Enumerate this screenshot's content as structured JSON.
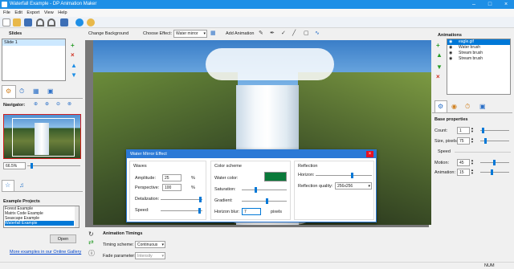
{
  "window": {
    "title": "Waterfall Example - DP Animation Maker"
  },
  "menu": [
    "File",
    "Edit",
    "Export",
    "View",
    "Help"
  ],
  "editbar": {
    "change_background": "Change Background",
    "choose_effect_label": "Choose Effect:",
    "effect_value": "Water mirror",
    "add_animation": "Add Animation"
  },
  "slides": {
    "title": "Slides",
    "items": [
      "Slide 1"
    ]
  },
  "navigator": {
    "title": "Navigator:",
    "zoom": "66.5%"
  },
  "projects": {
    "title": "Example Projects",
    "items": [
      "Forest Example",
      "Matrix Code Example",
      "Seascape Example",
      "Waterfall Example"
    ],
    "selected": 3,
    "open_label": "Open",
    "gallery_link": "More examples in our Online Gallery"
  },
  "timings": {
    "title": "Animation Timings",
    "timing_label": "Timing scheme:",
    "timing_value": "Continuous",
    "fade_label": "Fade parameter:",
    "fade_value": "Intensity"
  },
  "animations": {
    "title": "Animations",
    "items": [
      "eagle.gif",
      "Water brush",
      "Stream brush",
      "Stream brush"
    ],
    "selected": 0
  },
  "base_properties": {
    "title": "Base properties",
    "count_label": "Count:",
    "count_value": "1",
    "size_label": "Size, pixels:",
    "size_value": "75",
    "speed_header": "Speed",
    "motion_label": "Motion:",
    "motion_value": "45",
    "animation_label": "Animation:",
    "animation_value": "15"
  },
  "dialog": {
    "title": "Water Mirror Effect",
    "waves": {
      "header": "Waves",
      "amplitude_label": "Amplitude:",
      "amplitude_value": "25",
      "amplitude_unit": "%",
      "perspective_label": "Perspective:",
      "perspective_value": "100",
      "perspective_unit": "%",
      "detalization_label": "Detalization:",
      "speed_label": "Speed:"
    },
    "color_scheme": {
      "header": "Color scheme",
      "water_color_label": "Water color:",
      "water_color": "#0a7a3a",
      "saturation_label": "Saturation:",
      "gradient_label": "Gradient:",
      "horizon_blur_label": "Horizon blur:",
      "horizon_blur_value": "7",
      "horizon_blur_unit": "pixels"
    },
    "reflection": {
      "header": "Reflection",
      "horizon_label": "Horizon:",
      "quality_label": "Reflection quality:",
      "quality_value": "256x256"
    }
  },
  "statusbar": {
    "num": "NUM"
  },
  "colors": {
    "accent": "#1e8fe6",
    "selection": "#0078d7",
    "dialog_title": "#2b79d6",
    "close": "#e81123"
  }
}
